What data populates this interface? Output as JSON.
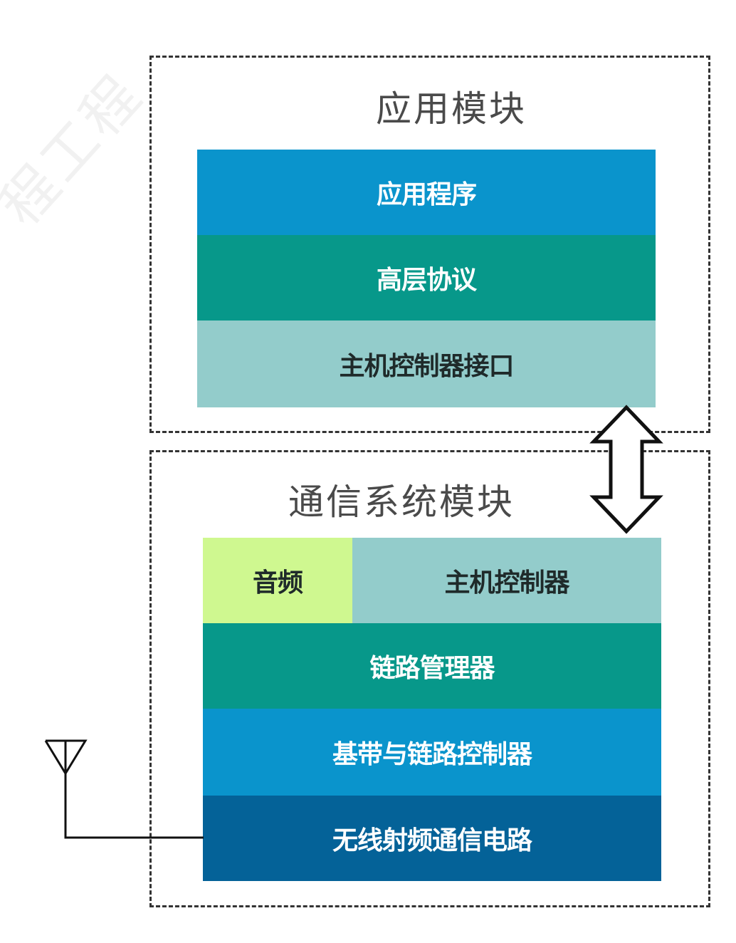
{
  "watermark": "程工程",
  "app_module": {
    "title": "应用模块",
    "layers": [
      {
        "label": "应用程序",
        "color": "#0a94cc"
      },
      {
        "label": "高层协议",
        "color": "#07988a"
      },
      {
        "label": "主机控制器接口",
        "color": "#93cccb"
      }
    ]
  },
  "comm_module": {
    "title": "通信系统模块",
    "audio_label": "音频",
    "host_controller_label": "主机控制器",
    "layers": [
      {
        "label": "链路管理器",
        "color": "#07988a"
      },
      {
        "label": "基带与链路控制器",
        "color": "#0a94cc"
      },
      {
        "label": "无线射频通信电路",
        "color": "#046298"
      }
    ]
  },
  "icons": {
    "arrow": "double-headed-vertical-arrow-icon",
    "antenna": "antenna-icon"
  }
}
